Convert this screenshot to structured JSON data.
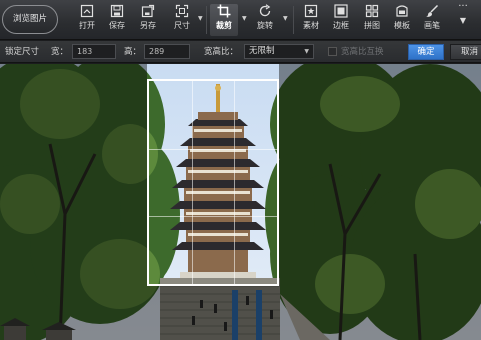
{
  "toolbar": {
    "browse_label": "浏览图片",
    "tools": [
      {
        "label": "打开",
        "icon": "open-icon"
      },
      {
        "label": "保存",
        "icon": "save-icon"
      },
      {
        "label": "另存",
        "icon": "save-as-icon"
      },
      {
        "label": "尺寸",
        "icon": "resize-icon"
      },
      {
        "label": "裁剪",
        "icon": "crop-icon",
        "active": true
      },
      {
        "label": "旋转",
        "icon": "rotate-icon"
      },
      {
        "label": "素材",
        "icon": "stickers-icon"
      },
      {
        "label": "边框",
        "icon": "frame-icon"
      },
      {
        "label": "拼图",
        "icon": "collage-icon"
      },
      {
        "label": "模板",
        "icon": "template-icon"
      },
      {
        "label": "画笔",
        "icon": "brush-icon"
      }
    ],
    "more_glyph": "···"
  },
  "crop_options": {
    "lock_size_label": "锁定尺寸",
    "width_label": "宽：",
    "width_value": "183",
    "height_label": "高：",
    "height_value": "289",
    "ratio_label": "宽高比：",
    "ratio_value": "无限制",
    "swap_label": "宽高比互换",
    "confirm_label": "确定",
    "cancel_label": "取消"
  },
  "colors": {
    "accent": "#3a80d6",
    "toolbar_bg": "#2b2d30"
  }
}
